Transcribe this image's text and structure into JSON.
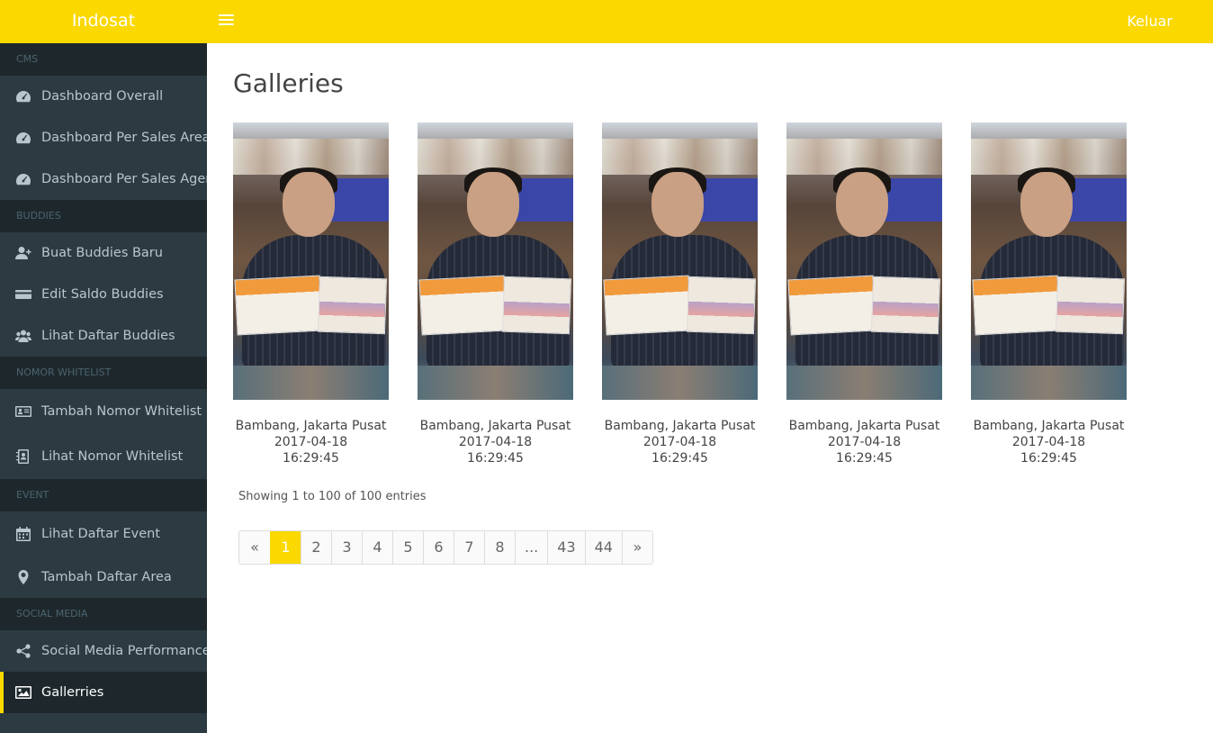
{
  "header": {
    "brand": "Indosat",
    "logout_label": "Keluar"
  },
  "sidebar": {
    "sections": [
      {
        "label": "CMS"
      },
      {
        "label": "BUDDIES"
      },
      {
        "label": "NOMOR WHITELIST"
      },
      {
        "label": "EVENT"
      },
      {
        "label": "SOCIAL MEDIA"
      }
    ],
    "items": [
      {
        "label": "Dashboard Overall",
        "icon": "dashboard-icon"
      },
      {
        "label": "Dashboard Per Sales Area",
        "icon": "dashboard-icon"
      },
      {
        "label": "Dashboard Per Sales Agent",
        "icon": "dashboard-icon"
      },
      {
        "label": "Buat Buddies Baru",
        "icon": "user-plus-icon"
      },
      {
        "label": "Edit Saldo Buddies",
        "icon": "credit-card-icon"
      },
      {
        "label": "Lihat Daftar Buddies",
        "icon": "users-icon"
      },
      {
        "label": "Tambah Nomor Whitelist",
        "icon": "id-card-icon"
      },
      {
        "label": "Lihat Nomor Whitelist",
        "icon": "contact-book-icon"
      },
      {
        "label": "Lihat Daftar Event",
        "icon": "calendar-icon"
      },
      {
        "label": "Tambah Daftar Area",
        "icon": "map-marker-icon"
      },
      {
        "label": "Social Media Performance",
        "icon": "share-icon"
      },
      {
        "label": "Gallerries",
        "icon": "image-icon",
        "active": true
      }
    ]
  },
  "main": {
    "title": "Galleries",
    "gallery": [
      {
        "name": "Bambang, Jakarta Pusat",
        "date": "2017-04-18",
        "time": "16:29:45"
      },
      {
        "name": "Bambang, Jakarta Pusat",
        "date": "2017-04-18",
        "time": "16:29:45"
      },
      {
        "name": "Bambang, Jakarta Pusat",
        "date": "2017-04-18",
        "time": "16:29:45"
      },
      {
        "name": "Bambang, Jakarta Pusat",
        "date": "2017-04-18",
        "time": "16:29:45"
      },
      {
        "name": "Bambang, Jakarta Pusat",
        "date": "2017-04-18",
        "time": "16:29:45"
      }
    ],
    "info": "Showing 1 to 100 of 100 entries",
    "pagination": [
      "«",
      "1",
      "2",
      "3",
      "4",
      "5",
      "6",
      "7",
      "8",
      "...",
      "43",
      "44",
      "»"
    ],
    "current_page": "1"
  },
  "colors": {
    "accent": "#fad800",
    "sidebar": "#2c3b41",
    "sidebar_section": "#1e282c",
    "sidebar_text": "#b8c7ce"
  }
}
